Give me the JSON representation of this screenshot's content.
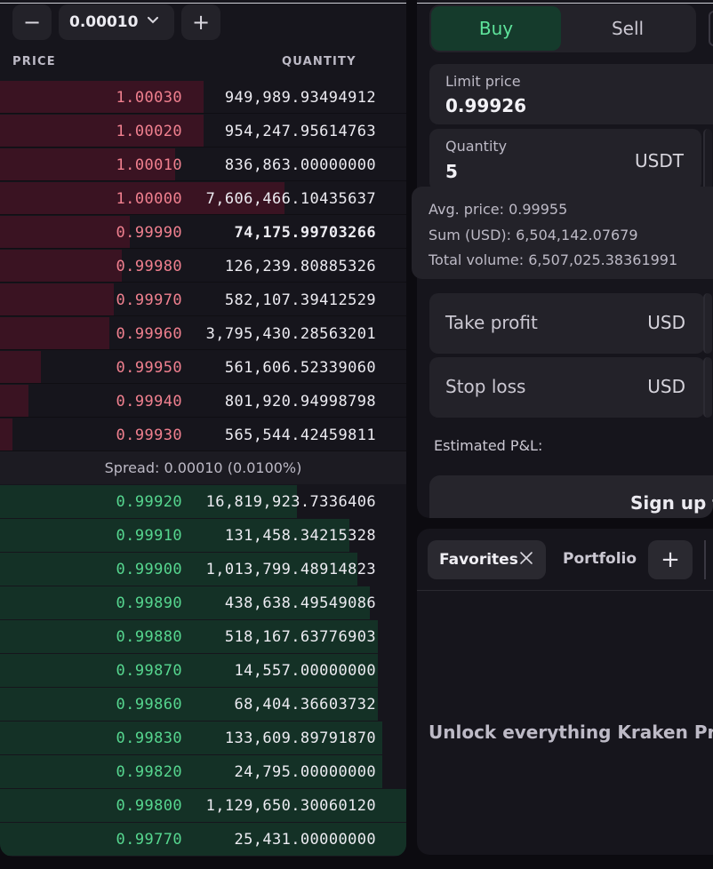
{
  "orderbook": {
    "step_value": "0.00010",
    "minus_label": "−",
    "plus_label": "+",
    "price_header": "PRICE",
    "quantity_header": "QUANTITY",
    "asks": [
      {
        "price": "1.00030",
        "qty": "949,989.93494912",
        "depth": 0.5
      },
      {
        "price": "1.00020",
        "qty": "954,247.95614763",
        "depth": 0.5
      },
      {
        "price": "1.00010",
        "qty": "836,863.00000000",
        "depth": 0.43
      },
      {
        "price": "1.00000",
        "qty": "7,606,466.10435637",
        "depth": 0.7
      },
      {
        "price": "0.99990",
        "qty": "74,175.99703266",
        "depth": 0.32
      },
      {
        "price": "0.99980",
        "qty": "126,239.80885326",
        "depth": 0.3
      },
      {
        "price": "0.99970",
        "qty": "582,107.39412529",
        "depth": 0.28
      },
      {
        "price": "0.99960",
        "qty": "3,795,430.28563201",
        "depth": 0.27
      },
      {
        "price": "0.99950",
        "qty": "561,606.52339060",
        "depth": 0.1
      },
      {
        "price": "0.99940",
        "qty": "801,920.94998798",
        "depth": 0.07
      },
      {
        "price": "0.99930",
        "qty": "565,544.42459811",
        "depth": 0.03
      }
    ],
    "spread_text": "Spread: 0.00010 (0.0100%)",
    "bids": [
      {
        "price": "0.99920",
        "qty": "16,819,923.7336406",
        "depth": 0.73
      },
      {
        "price": "0.99910",
        "qty": "131,458.34215328",
        "depth": 0.86
      },
      {
        "price": "0.99900",
        "qty": "1,013,799.48914823",
        "depth": 0.88
      },
      {
        "price": "0.99890",
        "qty": "438,638.49549086",
        "depth": 0.91
      },
      {
        "price": "0.99880",
        "qty": "518,167.63776903",
        "depth": 0.93
      },
      {
        "price": "0.99870",
        "qty": "14,557.00000000",
        "depth": 0.93
      },
      {
        "price": "0.99860",
        "qty": "68,404.36603732",
        "depth": 0.93
      },
      {
        "price": "0.99830",
        "qty": "133,609.89791870",
        "depth": 0.94
      },
      {
        "price": "0.99820",
        "qty": "24,795.00000000",
        "depth": 0.94
      },
      {
        "price": "0.99800",
        "qty": "1,129,650.30060120",
        "depth": 1.0
      },
      {
        "price": "0.99770",
        "qty": "25,431.00000000",
        "depth": 1.0
      }
    ]
  },
  "order_form": {
    "buy_label": "Buy",
    "sell_label": "Sell",
    "limit_price_label": "Limit price",
    "limit_price_value": "0.99926",
    "quantity_label": "Quantity",
    "quantity_value": "5",
    "quantity_unit": "USDT",
    "summary": {
      "avg_price": "Avg. price: 0.99955",
      "sum": "Sum (USD): 6,504,142.07679",
      "total_volume": "Total volume: 6,507,025.38361991"
    },
    "take_profit_label": "Take profit",
    "take_profit_unit": "USD",
    "stop_loss_label": "Stop loss",
    "stop_loss_unit": "USD",
    "estimated_pnl_label": "Estimated P&L:",
    "signup_label": "Sign up to"
  },
  "watchlist": {
    "favorites_tab": "Favorites",
    "portfolio_tab": "Portfolio",
    "add_tab": "+",
    "unlock_text": "Unlock everything Kraken Pro h"
  },
  "colors": {
    "ask_text": "#f0808f",
    "bid_text": "#56d68f",
    "ask_depth": "#3a1322",
    "bid_depth": "#143126",
    "buy_accent": "#5ee39b"
  }
}
